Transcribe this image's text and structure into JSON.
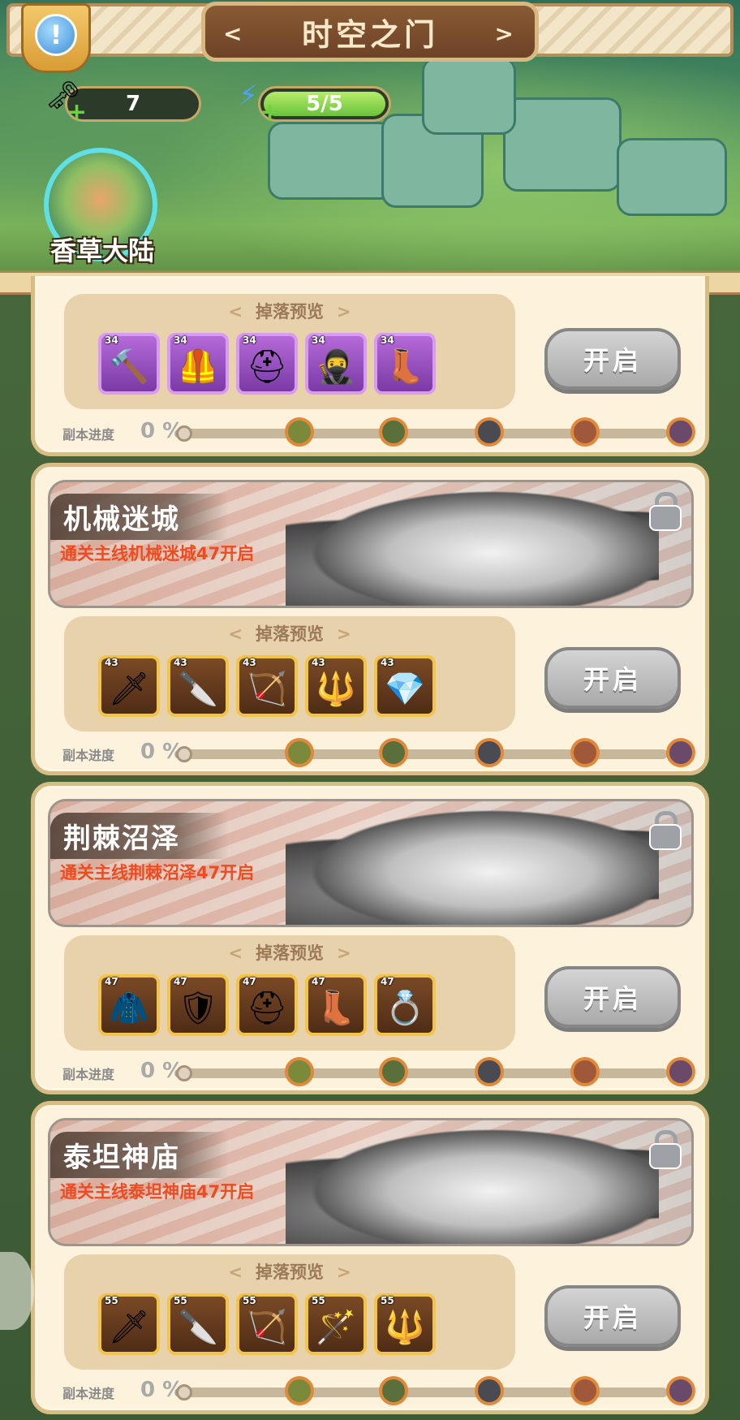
{
  "header": {
    "title": "时空之门",
    "keys": "7",
    "energy": "5/5",
    "energy_fraction": 1.0,
    "map_name": "香草大陆",
    "icons": {
      "info": "info-icon",
      "key": "key-icon",
      "energy": "lightning-icon"
    }
  },
  "common": {
    "drops_title": "掉落预览",
    "open_label": "开启",
    "progress_label": "副本进度",
    "progress_value": "0 %"
  },
  "panels": [
    {
      "locked": false,
      "items": [
        {
          "level": "34",
          "icon": "hammer-icon",
          "glyph": "🔨",
          "rarity": "purple"
        },
        {
          "level": "34",
          "icon": "chest-armor-icon",
          "glyph": "🦺",
          "rarity": "purple"
        },
        {
          "level": "34",
          "icon": "helmet-icon",
          "glyph": "⛑",
          "rarity": "purple"
        },
        {
          "level": "34",
          "icon": "hood-icon",
          "glyph": "🥷",
          "rarity": "purple"
        },
        {
          "level": "34",
          "icon": "boots-icon",
          "glyph": "👢",
          "rarity": "purple"
        }
      ],
      "bosses": [
        "goblin-boss-icon",
        "goblin-shaman-icon",
        "dark-beast-icon",
        "bandit-icon",
        "witch-icon"
      ]
    },
    {
      "name": "机械迷城",
      "requirement": "通关主线机械迷城47开启",
      "locked": true,
      "items": [
        {
          "level": "43",
          "icon": "scimitar-icon",
          "glyph": "🗡",
          "rarity": "gold"
        },
        {
          "level": "43",
          "icon": "blade-icon",
          "glyph": "🔪",
          "rarity": "gold"
        },
        {
          "level": "43",
          "icon": "bow-icon",
          "glyph": "🏹",
          "rarity": "gold"
        },
        {
          "level": "43",
          "icon": "staff-icon",
          "glyph": "🔱",
          "rarity": "gold"
        },
        {
          "level": "43",
          "icon": "wand-icon",
          "glyph": "💎",
          "rarity": "gold"
        }
      ],
      "bosses": [
        "mech-goblin-icon",
        "crystal-golem-icon",
        "fire-bot-icon",
        "engineer-icon",
        "goblin-chief-icon"
      ]
    },
    {
      "name": "荆棘沼泽",
      "requirement": "通关主线荆棘沼泽47开启",
      "locked": true,
      "items": [
        {
          "level": "47",
          "icon": "cloak-icon",
          "glyph": "🧥",
          "rarity": "gold"
        },
        {
          "level": "47",
          "icon": "armor-icon",
          "glyph": "🛡",
          "rarity": "gold"
        },
        {
          "level": "47",
          "icon": "helm-icon",
          "glyph": "⛑",
          "rarity": "gold"
        },
        {
          "level": "47",
          "icon": "boots-icon",
          "glyph": "👢",
          "rarity": "gold"
        },
        {
          "level": "47",
          "icon": "ring-icon",
          "glyph": "💍",
          "rarity": "gold"
        }
      ],
      "bosses": [
        "swamp-beast-icon",
        "troll-icon",
        "boar-icon",
        "ogre-icon",
        "orc-icon"
      ]
    },
    {
      "name": "泰坦神庙",
      "requirement": "通关主线泰坦神庙47开启",
      "locked": true,
      "items": [
        {
          "level": "55",
          "icon": "greatsword-icon",
          "glyph": "🗡",
          "rarity": "gold"
        },
        {
          "level": "55",
          "icon": "dagger-icon",
          "glyph": "🔪",
          "rarity": "gold"
        },
        {
          "level": "55",
          "icon": "bow-icon",
          "glyph": "🏹",
          "rarity": "gold"
        },
        {
          "level": "55",
          "icon": "scepter-icon",
          "glyph": "🪄",
          "rarity": "gold"
        },
        {
          "level": "55",
          "icon": "spear-icon",
          "glyph": "🔱",
          "rarity": "gold"
        }
      ],
      "bosses": [
        "fire-spirit-icon",
        "ice-mage-icon",
        "stone-titan-icon",
        "beast-icon",
        "warlord-icon"
      ]
    }
  ]
}
